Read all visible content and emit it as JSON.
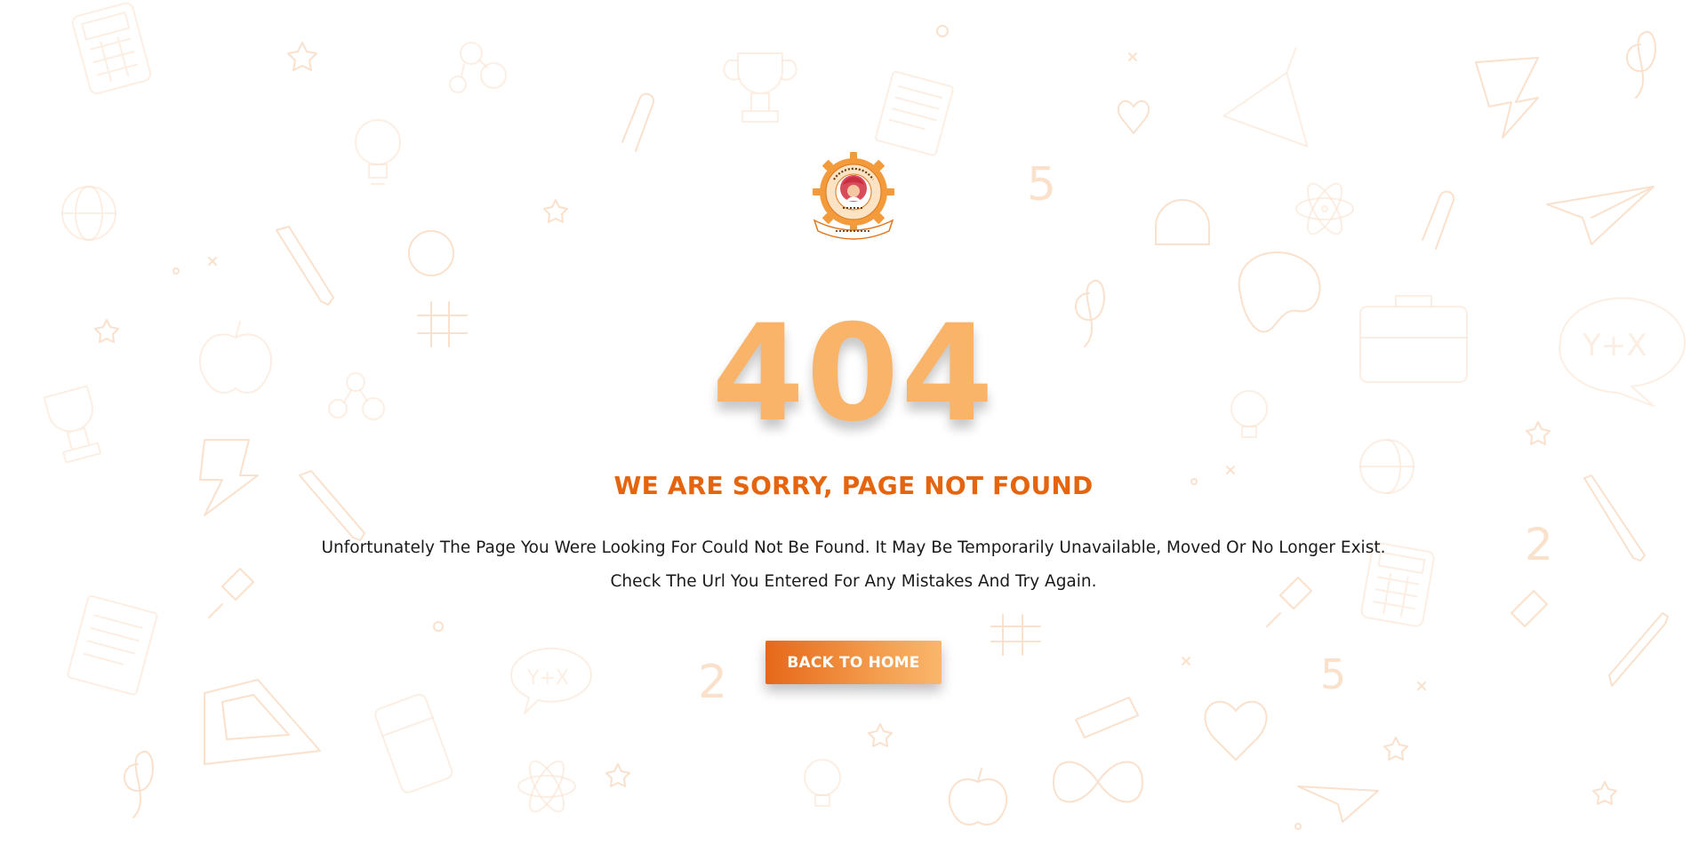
{
  "error": {
    "code": "404",
    "headline": "WE ARE SORRY, PAGE NOT FOUND",
    "message_line_1": "Unfortunately The Page You Were Looking For Could Not Be Found. It May Be Temporarily Unavailable, Moved Or No Longer Exist.",
    "message_line_2": "Check The Url You Entered For Any Mistakes And Try Again."
  },
  "actions": {
    "back_home_label": "BACK TO HOME"
  },
  "logo": {
    "icon": "college-emblem-icon",
    "lettering_top": "रयत शिक्षण संस्थेचे महाविद्यालय",
    "lettering_bottom": "तमसो मा ज्योतिर्गमय"
  },
  "background": {
    "pattern": "school-doodles"
  },
  "colors": {
    "accent_orange": "#e5650f",
    "code_orange": "#f9b46a",
    "button_gradient_start": "#e6681a",
    "button_gradient_end": "#f9b76c",
    "doodle_stroke": "#f6c9a4",
    "text_dark": "#1a1a1a"
  }
}
